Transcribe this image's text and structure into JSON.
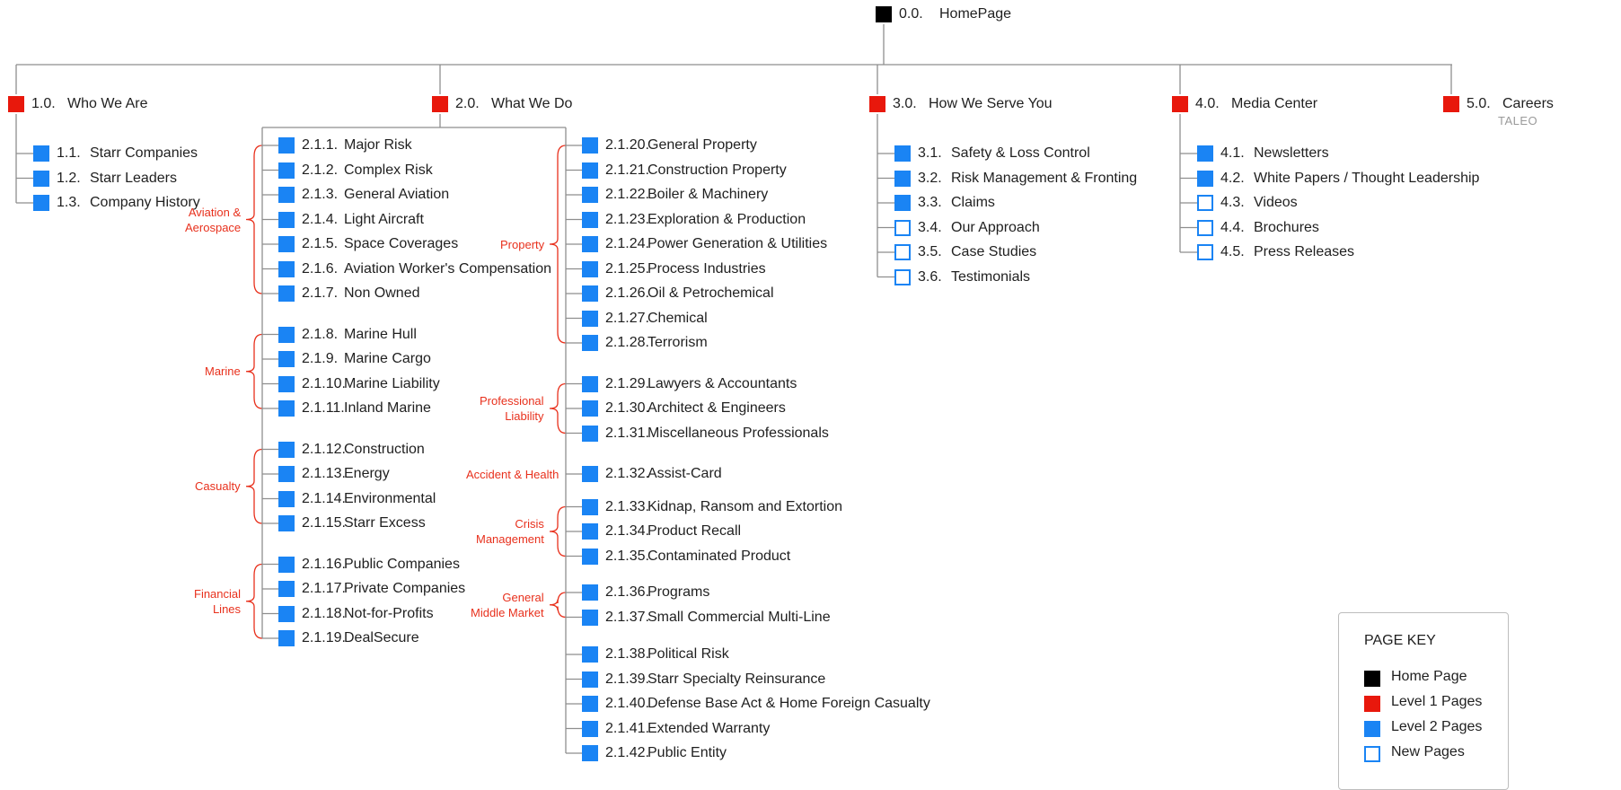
{
  "colors": {
    "home": "#000000",
    "level1": "#e8180c",
    "level2": "#1a84f4",
    "group": "#e8301c",
    "line": "#8e8e8e"
  },
  "root": {
    "num": "0.0.",
    "label": "HomePage",
    "type": "home"
  },
  "sections": [
    {
      "num": "1.0.",
      "label": "Who We Are",
      "type": "level1",
      "children": [
        {
          "num": "1.1.",
          "label": "Starr Companies",
          "type": "level2"
        },
        {
          "num": "1.2.",
          "label": "Starr Leaders",
          "type": "level2"
        },
        {
          "num": "1.3.",
          "label": "Company History",
          "type": "level2"
        }
      ]
    },
    {
      "num": "2.0.",
      "label": "What We Do",
      "type": "level1",
      "children": []
    },
    {
      "num": "3.0.",
      "label": "How We Serve You",
      "type": "level1",
      "children": [
        {
          "num": "3.1.",
          "label": "Safety & Loss Control",
          "type": "level2"
        },
        {
          "num": "3.2.",
          "label": "Risk Management & Fronting",
          "type": "level2"
        },
        {
          "num": "3.3.",
          "label": "Claims",
          "type": "level2"
        },
        {
          "num": "3.4.",
          "label": "Our Approach",
          "type": "new"
        },
        {
          "num": "3.5.",
          "label": "Case Studies",
          "type": "new"
        },
        {
          "num": "3.6.",
          "label": "Testimonials",
          "type": "new"
        }
      ]
    },
    {
      "num": "4.0.",
      "label": "Media Center",
      "type": "level1",
      "children": [
        {
          "num": "4.1.",
          "label": "Newsletters",
          "type": "level2"
        },
        {
          "num": "4.2.",
          "label": "White Papers / Thought Leadership",
          "type": "level2"
        },
        {
          "num": "4.3.",
          "label": "Videos",
          "type": "new"
        },
        {
          "num": "4.4.",
          "label": "Brochures",
          "type": "new"
        },
        {
          "num": "4.5.",
          "label": "Press Releases",
          "type": "new"
        }
      ]
    },
    {
      "num": "5.0.",
      "label": "Careers",
      "type": "level1",
      "sublabel": "TALEO",
      "children": []
    }
  ],
  "what_we_do": {
    "left_groups": [
      {
        "name": "Aviation & Aerospace",
        "lines": [
          "Aviation &",
          "Aerospace"
        ],
        "items": [
          {
            "num": "2.1.1.",
            "label": "Major Risk"
          },
          {
            "num": "2.1.2.",
            "label": "Complex Risk"
          },
          {
            "num": "2.1.3.",
            "label": "General Aviation"
          },
          {
            "num": "2.1.4.",
            "label": "Light Aircraft"
          },
          {
            "num": "2.1.5.",
            "label": "Space Coverages"
          },
          {
            "num": "2.1.6.",
            "label": "Aviation Worker's Compensation"
          },
          {
            "num": "2.1.7.",
            "label": "Non Owned"
          }
        ]
      },
      {
        "name": "Marine",
        "lines": [
          "Marine"
        ],
        "items": [
          {
            "num": "2.1.8.",
            "label": "Marine Hull"
          },
          {
            "num": "2.1.9.",
            "label": "Marine Cargo"
          },
          {
            "num": "2.1.10.",
            "label": "Marine Liability"
          },
          {
            "num": "2.1.11.",
            "label": "Inland Marine"
          }
        ]
      },
      {
        "name": "Casualty",
        "lines": [
          "Casualty"
        ],
        "items": [
          {
            "num": "2.1.12.",
            "label": "Construction"
          },
          {
            "num": "2.1.13.",
            "label": "Energy"
          },
          {
            "num": "2.1.14.",
            "label": "Environmental"
          },
          {
            "num": "2.1.15.",
            "label": "Starr Excess"
          }
        ]
      },
      {
        "name": "Financial Lines",
        "lines": [
          "Financial",
          "Lines"
        ],
        "items": [
          {
            "num": "2.1.16.",
            "label": "Public Companies"
          },
          {
            "num": "2.1.17.",
            "label": "Private Companies"
          },
          {
            "num": "2.1.18.",
            "label": "Not-for-Profits"
          },
          {
            "num": "2.1.19.",
            "label": "DealSecure"
          }
        ]
      }
    ],
    "right_groups": [
      {
        "name": "Property",
        "lines": [
          "Property"
        ],
        "items": [
          {
            "num": "2.1.20.",
            "label": "General Property"
          },
          {
            "num": "2.1.21.",
            "label": "Construction Property"
          },
          {
            "num": "2.1.22.",
            "label": "Boiler & Machinery"
          },
          {
            "num": "2.1.23.",
            "label": "Exploration & Production"
          },
          {
            "num": "2.1.24.",
            "label": "Power Generation & Utilities"
          },
          {
            "num": "2.1.25.",
            "label": "Process Industries"
          },
          {
            "num": "2.1.26.",
            "label": "Oil & Petrochemical"
          },
          {
            "num": "2.1.27.",
            "label": "Chemical"
          },
          {
            "num": "2.1.28.",
            "label": "Terrorism"
          }
        ]
      },
      {
        "name": "Professional Liability",
        "lines": [
          "Professional",
          "Liability"
        ],
        "items": [
          {
            "num": "2.1.29.",
            "label": "Lawyers & Accountants"
          },
          {
            "num": "2.1.30.",
            "label": "Architect & Engineers"
          },
          {
            "num": "2.1.31.",
            "label": "Miscellaneous Professionals"
          }
        ]
      },
      {
        "name": "Accident & Health",
        "lines": [
          "Accident & Health"
        ],
        "items": [
          {
            "num": "2.1.32.",
            "label": "Assist-Card"
          }
        ]
      },
      {
        "name": "Crisis Management",
        "lines": [
          "Crisis",
          "Management"
        ],
        "items": [
          {
            "num": "2.1.33.",
            "label": "Kidnap, Ransom and Extortion"
          },
          {
            "num": "2.1.34.",
            "label": "Product Recall"
          },
          {
            "num": "2.1.35.",
            "label": "Contaminated Product"
          }
        ]
      },
      {
        "name": "General Middle Market",
        "lines": [
          "General",
          "Middle Market"
        ],
        "items": [
          {
            "num": "2.1.36.",
            "label": "Programs"
          },
          {
            "num": "2.1.37.",
            "label": "Small Commercial Multi-Line"
          }
        ]
      },
      {
        "name": "",
        "lines": [],
        "items": [
          {
            "num": "2.1.38.",
            "label": "Political Risk"
          },
          {
            "num": "2.1.39.",
            "label": "Starr Specialty Reinsurance"
          },
          {
            "num": "2.1.40.",
            "label": "Defense Base Act & Home Foreign Casualty"
          },
          {
            "num": "2.1.41.",
            "label": "Extended Warranty"
          },
          {
            "num": "2.1.42.",
            "label": "Public Entity"
          }
        ]
      }
    ]
  },
  "page_key": {
    "title": "PAGE KEY",
    "items": [
      {
        "label": "Home Page",
        "type": "home"
      },
      {
        "label": "Level 1 Pages",
        "type": "level1"
      },
      {
        "label": "Level 2 Pages",
        "type": "level2"
      },
      {
        "label": "New Pages",
        "type": "new"
      }
    ]
  }
}
